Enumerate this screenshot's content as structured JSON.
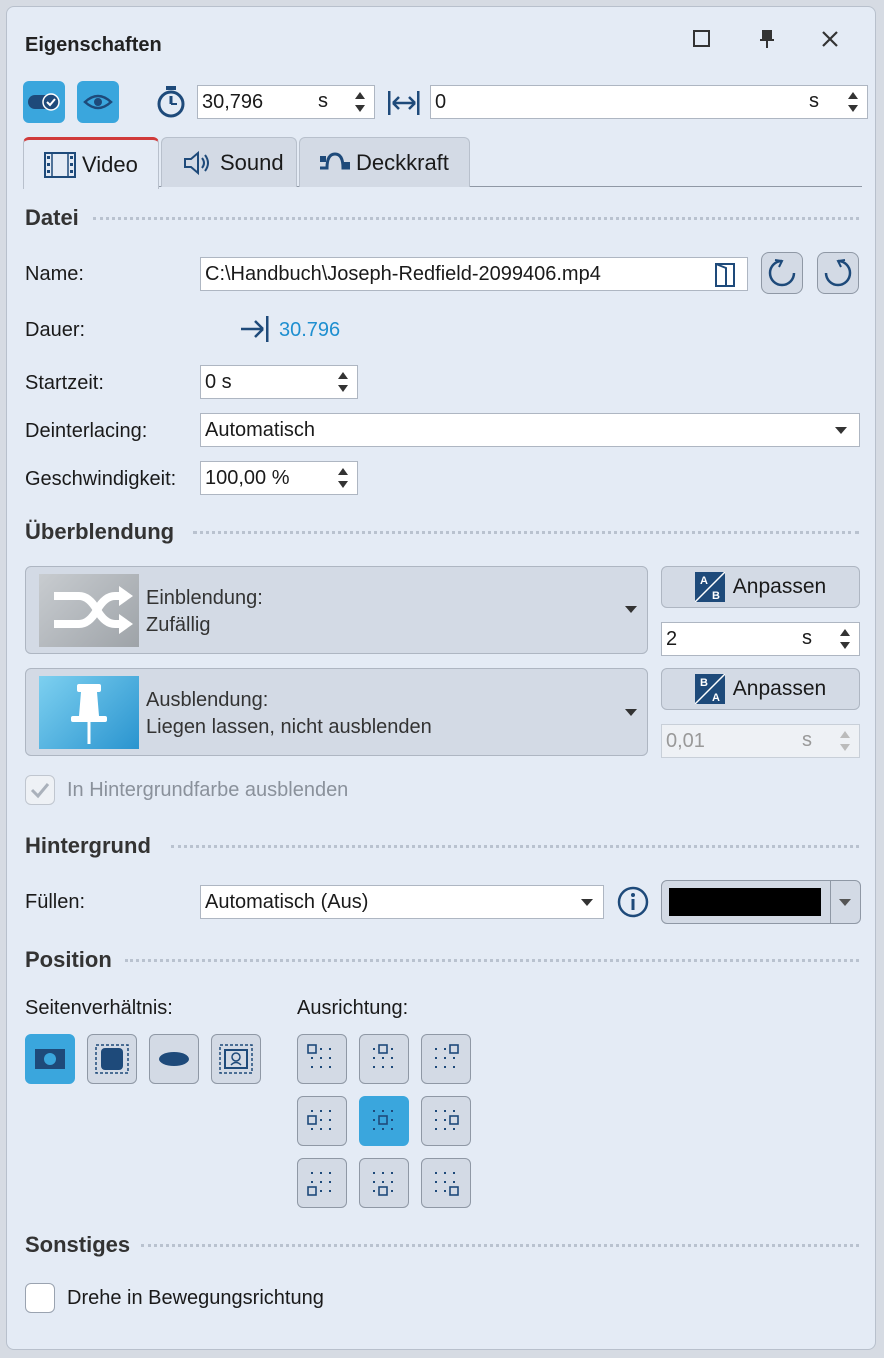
{
  "window": {
    "title": "Eigenschaften"
  },
  "toolbar": {
    "duration_value": "30,796",
    "duration_unit": "s",
    "offset_value": "0",
    "offset_unit": "s"
  },
  "tabs": [
    {
      "label": "Video",
      "active": true
    },
    {
      "label": "Sound",
      "active": false
    },
    {
      "label": "Deckkraft",
      "active": false
    }
  ],
  "datei": {
    "heading": "Datei",
    "name_label": "Name:",
    "name_value": "C:\\Handbuch\\Joseph-Redfield-2099406.mp4",
    "dauer_label": "Dauer:",
    "dauer_value": "30.796",
    "startzeit_label": "Startzeit:",
    "startzeit_value": "0 s",
    "deinterlacing_label": "Deinterlacing:",
    "deinterlacing_value": "Automatisch",
    "geschwindigkeit_label": "Geschwindigkeit:",
    "geschwindigkeit_value": "100,00 %"
  },
  "ueberblendung": {
    "heading": "Überblendung",
    "einblendung_title": "Einblendung:",
    "einblendung_value": "Zufällig",
    "ausblendung_title": "Ausblendung:",
    "ausblendung_value": "Liegen lassen, nicht ausblenden",
    "anpassen_label": "Anpassen",
    "ein_duration": "2",
    "aus_duration": "0,01",
    "unit": "s",
    "hintergrund_checkbox": "In Hintergrundfarbe ausblenden"
  },
  "hintergrund": {
    "heading": "Hintergrund",
    "fuellen_label": "Füllen:",
    "fuellen_value": "Automatisch (Aus)",
    "color": "#000000"
  },
  "position": {
    "heading": "Position",
    "seitenverhaeltnis_label": "Seitenverhältnis:",
    "ausrichtung_label": "Ausrichtung:",
    "selected_aspect": 0,
    "selected_alignment": 4
  },
  "sonstiges": {
    "heading": "Sonstiges",
    "drehe_label": "Drehe in Bewegungsrichtung"
  },
  "colors": {
    "accent": "#3aa6dd",
    "active_tab_border": "#d03a3a",
    "link_blue": "#1e8fd0"
  }
}
